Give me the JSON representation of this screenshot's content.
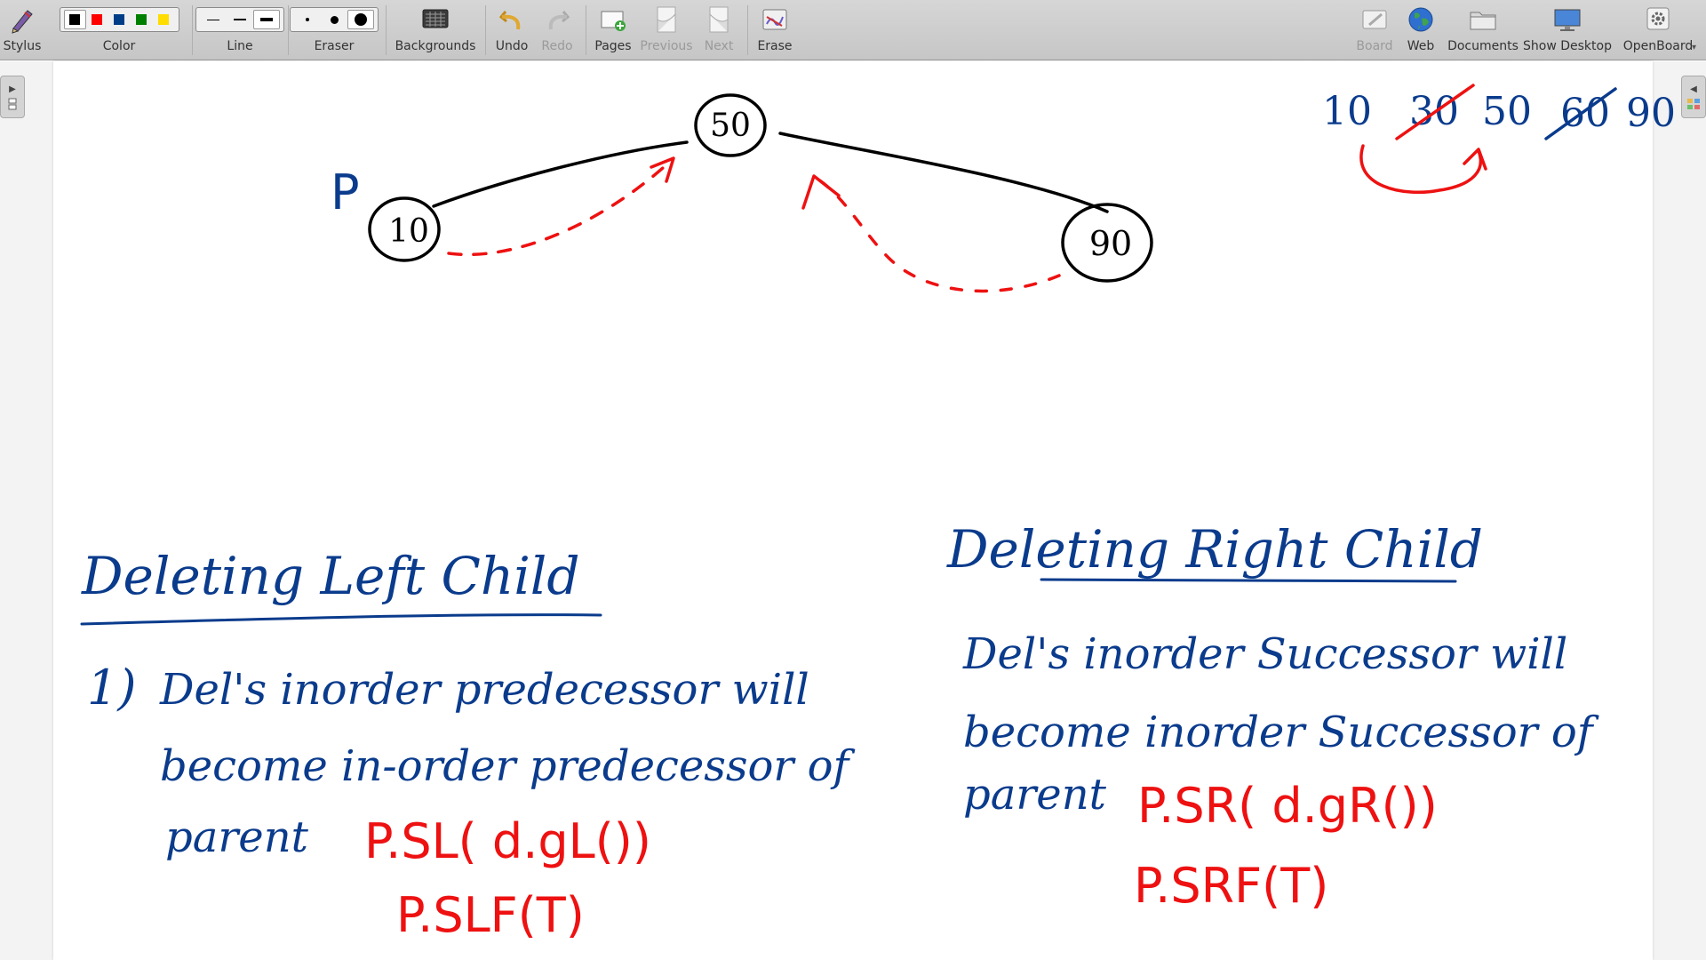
{
  "toolbar": {
    "stylus": "Stylus",
    "color": "Color",
    "line": "Line",
    "eraser": "Eraser",
    "backgrounds": "Backgrounds",
    "undo": "Undo",
    "redo": "Redo",
    "pages": "Pages",
    "previous": "Previous",
    "next": "Next",
    "erase": "Erase",
    "board": "Board",
    "web": "Web",
    "documents": "Documents",
    "show_desktop": "Show Desktop",
    "openboard": "OpenBoard"
  },
  "palette_colors": [
    "#000000",
    "#ff0000",
    "#003f87",
    "#008000",
    "#ffdd00"
  ],
  "ink_colors": {
    "black": "#000000",
    "red": "#ee1111",
    "blue": "#0a3b8c"
  },
  "tree": {
    "root": "50",
    "left": "10",
    "right": "90",
    "parent_label": "P"
  },
  "sequence": {
    "items": [
      "10",
      "30",
      "50",
      "60",
      "90"
    ],
    "struck": [
      "30",
      "60"
    ]
  },
  "left_note": {
    "heading": "Deleting Left Child",
    "number": "1)",
    "line1": "Del's inorder predecessor will",
    "line2": "become in-order predecessor of",
    "line3": "parent",
    "code1": "P.SL( d.gL())",
    "code2": "P.SLF(T)"
  },
  "right_note": {
    "heading": "Deleting Right Child",
    "line1": "Del's inorder Successor will",
    "line2": "become inorder Successor of",
    "line3": "parent",
    "code1": "P.SR( d.gR())",
    "code2": "P.SRF(T)"
  }
}
